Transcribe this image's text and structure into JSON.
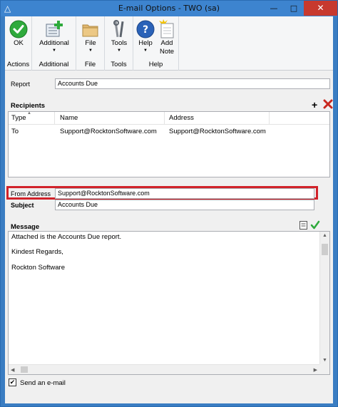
{
  "window": {
    "title": "E-mail Options  -  TWO (sa)",
    "app_icon": "dynamics-gp-icon",
    "controls": [
      "minimize-icon",
      "maximize-icon",
      "close-icon"
    ]
  },
  "ribbon": {
    "groups": [
      {
        "label": "Actions",
        "buttons": [
          {
            "label": "OK",
            "icon": "ok-check-icon"
          }
        ]
      },
      {
        "label": "Additional",
        "buttons": [
          {
            "label": "Additional",
            "icon": "additional-icon",
            "dropdown": true
          }
        ]
      },
      {
        "label": "File",
        "buttons": [
          {
            "label": "File",
            "icon": "folder-icon",
            "dropdown": true
          }
        ]
      },
      {
        "label": "Tools",
        "buttons": [
          {
            "label": "Tools",
            "icon": "tools-icon",
            "dropdown": true
          }
        ]
      },
      {
        "label": "Help",
        "buttons": [
          {
            "label": "Help",
            "icon": "help-icon",
            "dropdown": true
          },
          {
            "label": "Add Note",
            "icon": "add-note-icon",
            "line1": "Add",
            "line2": "Note"
          }
        ]
      }
    ]
  },
  "report": {
    "label": "Report",
    "value": "Accounts Due"
  },
  "recipients": {
    "title": "Recipients",
    "add_icon": "plus-icon",
    "delete_icon": "delete-x-icon",
    "columns": [
      "Type",
      "Name",
      "Address"
    ],
    "rows": [
      {
        "type": "To",
        "name": "Support@RocktonSoftware.com",
        "address": "Support@RocktonSoftware.com"
      }
    ]
  },
  "from_address": {
    "label": "From Address",
    "value": "Support@RocktonSoftware.com"
  },
  "subject": {
    "label": "Subject",
    "value": "Accounts Due"
  },
  "message": {
    "title": "Message",
    "icons": [
      "note-icon",
      "spellcheck-icon"
    ],
    "lines": [
      "Attached is the Accounts Due report.",
      "Kindest Regards,",
      "Rockton Software"
    ]
  },
  "send_email": {
    "label": "Send an e-mail",
    "checked": true
  },
  "colors": {
    "title_bar": "#3d84cf",
    "close_button": "#c7392e",
    "highlight_box": "#d1222a",
    "ok_green": "#2eaa3c"
  }
}
